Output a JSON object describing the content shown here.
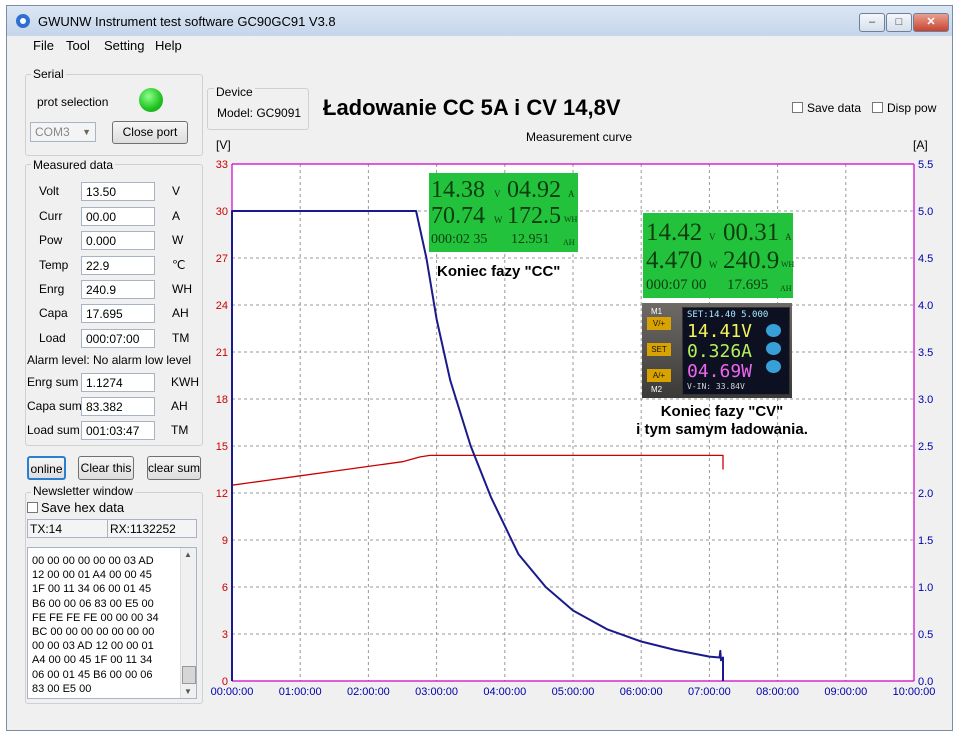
{
  "window": {
    "title": "GWUNW Instrument test software GC90GC91 V3.8",
    "minimize": "–",
    "maximize": "□",
    "close": "✕"
  },
  "menu": [
    "File",
    "Tool",
    "Setting",
    "Help"
  ],
  "serial": {
    "group_label": "Serial",
    "prot_label": "prot selection",
    "led_color": "#22cc22",
    "port_value": "COM3",
    "close_port_label": "Close port"
  },
  "measured": {
    "group_label": "Measured data",
    "rows": [
      {
        "label": "Volt",
        "value": "13.50",
        "unit": "V"
      },
      {
        "label": "Curr",
        "value": "00.00",
        "unit": "A"
      },
      {
        "label": "Pow",
        "value": "0.000",
        "unit": "W"
      },
      {
        "label": "Temp",
        "value": "22.9",
        "unit": "℃"
      },
      {
        "label": "Enrg",
        "value": "240.9",
        "unit": "WH"
      },
      {
        "label": "Capa",
        "value": "17.695",
        "unit": "AH"
      },
      {
        "label": "Load",
        "value": "000:07:00",
        "unit": "TM"
      }
    ],
    "alarm_text": "Alarm level:  No alarm low level",
    "sums": [
      {
        "label": "Enrg sum",
        "value": "1.1274",
        "unit": "KWH"
      },
      {
        "label": "Capa sum",
        "value": "83.382",
        "unit": "AH"
      },
      {
        "label": "Load sum",
        "value": "001:03:47",
        "unit": "TM"
      }
    ]
  },
  "buttons": {
    "online": "online",
    "clear_this": "Clear this",
    "clear_sum": "clear sum"
  },
  "newsletter": {
    "group_label": "Newsletter window",
    "save_hex_label": "Save hex data",
    "tx": "TX:14",
    "rx": "RX:1132252",
    "hex_lines": [
      "00 00 00 00 00 00 03 AD",
      "12 00 00 01 A4 00 00 45",
      "1F 00 11 34 06 00 01 45",
      "B6 00 00 06 83 00 E5 00",
      "FE FE FE FE 00 00 00 34",
      "BC 00 00 00 00 00 00 00",
      "00 00 03 AD 12 00 00 01",
      "A4 00 00 45 1F 00 11 34",
      "06 00 01 45 B6 00 00 06",
      "83 00 E5 00"
    ]
  },
  "device": {
    "group_label": "Device",
    "model": "Model: GC9091"
  },
  "headline": "Ładowanie CC 5A i CV 14,8V",
  "options": {
    "save_data": "Save data",
    "disp_pow": "Disp pow"
  },
  "chart_data": {
    "type": "line",
    "title": "Measurement curve",
    "ylabel_left": "[V]",
    "ylabel_right": "[A]",
    "xlim_hours": [
      0,
      10
    ],
    "ylim_left": [
      0,
      33
    ],
    "ylim_right": [
      0,
      5.5
    ],
    "x_ticks": [
      "00:00:00",
      "01:00:00",
      "02:00:00",
      "03:00:00",
      "04:00:00",
      "05:00:00",
      "06:00:00",
      "07:00:00",
      "08:00:00",
      "09:00:00",
      "10:00:00"
    ],
    "y_ticks_left": [
      "0",
      "3",
      "6",
      "9",
      "12",
      "15",
      "18",
      "21",
      "24",
      "27",
      "30",
      "33"
    ],
    "y_ticks_right": [
      "0.0",
      "0.5",
      "1.0",
      "1.5",
      "2.0",
      "2.5",
      "3.0",
      "3.5",
      "4.0",
      "4.5",
      "5.0",
      "5.5"
    ],
    "grid": true,
    "series": [
      {
        "color": "#cc0000",
        "axis": "left",
        "x": [
          0.0,
          0.0,
          0.5,
          1.0,
          1.5,
          2.0,
          2.5,
          2.75,
          2.9,
          3.5,
          4.5,
          5.5,
          6.5,
          7.2,
          7.2
        ],
        "y": [
          0,
          12.5,
          12.8,
          13.1,
          13.4,
          13.7,
          14.0,
          14.3,
          14.4,
          14.4,
          14.4,
          14.4,
          14.4,
          14.4,
          13.5
        ]
      },
      {
        "color": "#1a1a8c",
        "axis": "right",
        "x": [
          0.0,
          0.0,
          0.05,
          2.7,
          2.85,
          3.0,
          3.2,
          3.5,
          3.8,
          4.2,
          4.6,
          5.0,
          5.5,
          6.0,
          6.5,
          7.0,
          7.15,
          7.16,
          7.17,
          7.2,
          7.2
        ],
        "y": [
          0,
          5.0,
          5.0,
          5.0,
          4.5,
          3.85,
          3.2,
          2.5,
          1.95,
          1.35,
          1.0,
          0.75,
          0.55,
          0.42,
          0.33,
          0.26,
          0.25,
          0.32,
          0.22,
          0.25,
          0.0
        ]
      }
    ]
  },
  "overlays": {
    "cc_caption": "Koniec fazy \"CC\"",
    "cv_caption_line1": "Koniec fazy \"CV\"",
    "cv_caption_line2": "i tym samym ładowania.",
    "lcd1": {
      "v": "14.38",
      "v_u": "V",
      "a": "04.92",
      "a_u": "A",
      "w": "70.74",
      "w_u": "W",
      "wh": "172.5",
      "wh_u": "WH",
      "t": "000:02 35",
      "ah": "12.951",
      "ah_u": "AH"
    },
    "lcd2": {
      "v": "14.42",
      "v_u": "V",
      "a": "00.31",
      "a_u": "A",
      "w": "4.470",
      "w_u": "W",
      "wh": "240.9",
      "wh_u": "WH",
      "t": "000:07 00",
      "ah": "17.695",
      "ah_u": "AH"
    },
    "device_photo": {
      "set_line": "SET:14.40 5.000",
      "v": "14.41V",
      "a": "0.326A",
      "w": "04.69W",
      "vin": "V-IN: 33.84V",
      "m1": "M1",
      "m2": "M2",
      "btn1": "V/+",
      "btn2": "SET",
      "btn3": "A/+"
    }
  }
}
